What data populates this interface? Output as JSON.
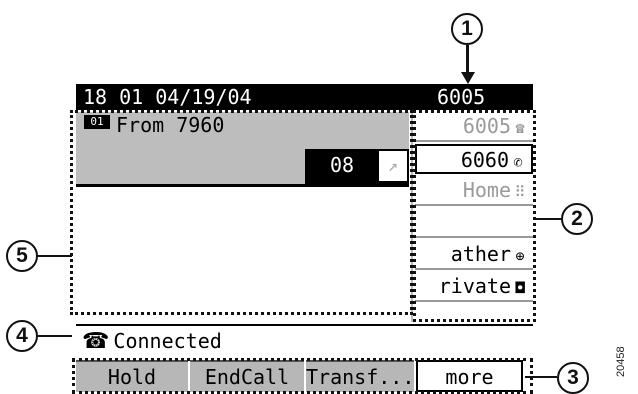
{
  "header": {
    "datetime": "18 01 04/19/04",
    "extension": "6005"
  },
  "call": {
    "line_icon": "01",
    "from": "From 7960",
    "timer": "08"
  },
  "lines": [
    {
      "label": "6005",
      "icon": "phone-icon",
      "glyph": "☎",
      "state": "inactive"
    },
    {
      "label": "6060",
      "icon": "handset-icon",
      "glyph": "✆",
      "state": "selected"
    },
    {
      "label": "Home",
      "icon": "speed-dial-icon",
      "glyph": "⠿",
      "state": "inactive"
    },
    {
      "label": "",
      "icon": "",
      "glyph": "",
      "state": "empty"
    },
    {
      "label": "ather",
      "icon": "globe-icon",
      "glyph": "⊕",
      "state": "active"
    },
    {
      "label": "rivate",
      "icon": "service-icon",
      "glyph": "◘",
      "state": "active"
    }
  ],
  "status": {
    "text": "Connected",
    "handset_glyph": "☎"
  },
  "softkeys": [
    {
      "label": "Hold"
    },
    {
      "label": "EndCall"
    },
    {
      "label": "Transf..."
    },
    {
      "label": "more"
    }
  ],
  "callouts": [
    "1",
    "2",
    "3",
    "4",
    "5"
  ],
  "figure_code": "20458"
}
